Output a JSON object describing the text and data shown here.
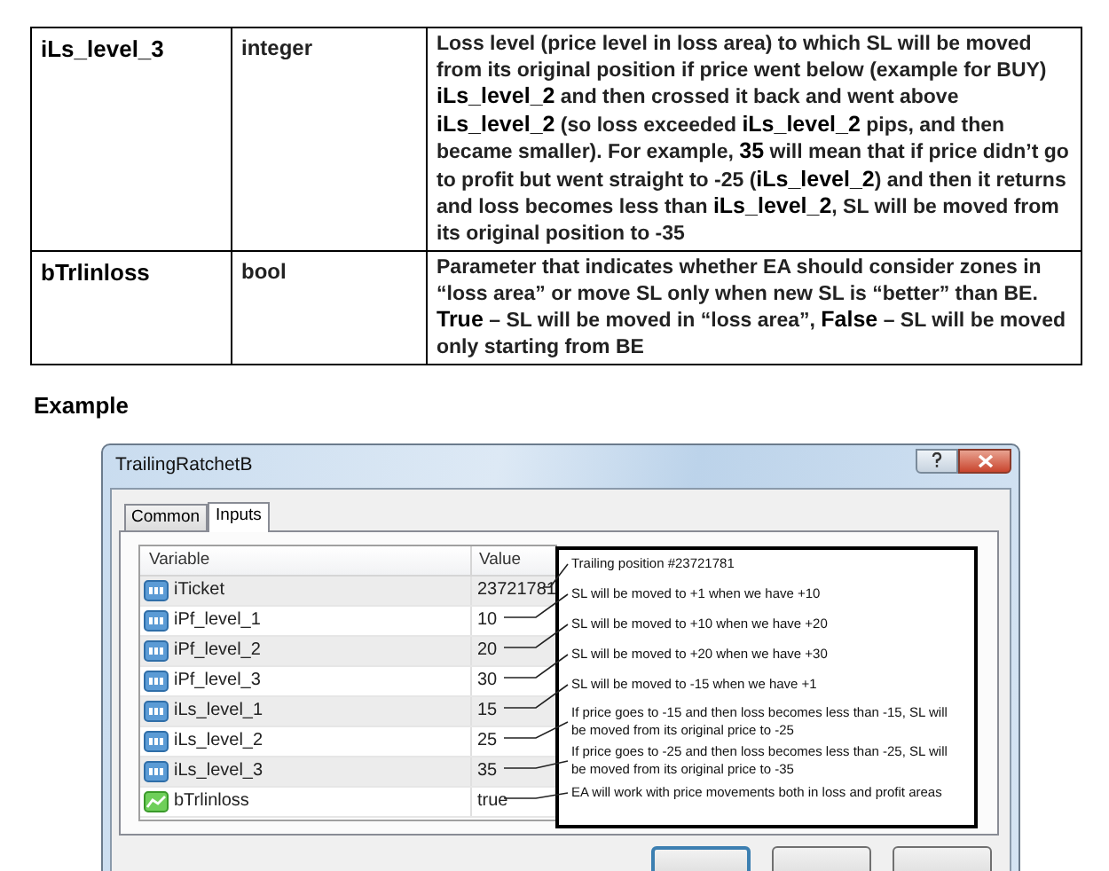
{
  "table": {
    "rows": [
      {
        "name": "iLs_level_3",
        "type": "integer",
        "description": "Loss level (price level in loss area) to which SL will be moved from its original position if price went below (example for BUY) **iLs_level_2** and then crossed it back and went above **iLs_level_2** (so loss exceeded **iLs_level_2** pips, and then became smaller). For example, **35** will mean that if price didn’t go to profit but went straight to -25 (**iLs_level_2**) and then it returns and loss becomes less than **iLs_level_2**, SL will be moved from its original position to -35"
      },
      {
        "name": "bTrlinloss",
        "type": "bool",
        "description": "Parameter that indicates whether EA should consider zones in “loss area” or move SL only when new SL is “better” than BE. **True** – SL will be moved in “loss area”, **False** – SL will be moved only starting from BE"
      }
    ]
  },
  "section_heading": "Example",
  "dialog": {
    "title": "TrailingRatchetB",
    "tabs": [
      {
        "label": "Common",
        "selected": false
      },
      {
        "label": "Inputs",
        "selected": true
      }
    ],
    "grid": {
      "columns": [
        "Variable",
        "Value"
      ],
      "rows": [
        {
          "kind": "int",
          "variable": "iTicket",
          "value": "23721781"
        },
        {
          "kind": "int",
          "variable": "iPf_level_1",
          "value": "10"
        },
        {
          "kind": "int",
          "variable": "iPf_level_2",
          "value": "20"
        },
        {
          "kind": "int",
          "variable": "iPf_level_3",
          "value": "30"
        },
        {
          "kind": "int",
          "variable": "iLs_level_1",
          "value": "15"
        },
        {
          "kind": "int",
          "variable": "iLs_level_2",
          "value": "25"
        },
        {
          "kind": "int",
          "variable": "iLs_level_3",
          "value": "35"
        },
        {
          "kind": "bool",
          "variable": "bTrlinloss",
          "value": "true"
        }
      ]
    },
    "callout": {
      "notes": [
        "Trailing position #23721781",
        "SL will be moved to +1 when we have +10",
        "SL will be moved to +10 when we have +20",
        "SL will be moved to +20 when we have +30",
        "SL will be moved to -15 when we have +1",
        "If price goes to -15 and then loss becomes less than -15, SL will be moved from its original price to -25",
        "If price goes to -25 and then loss becomes less than -25, SL will be moved from its original price to -35",
        "EA will work with price movements both in loss and profit areas"
      ]
    }
  }
}
